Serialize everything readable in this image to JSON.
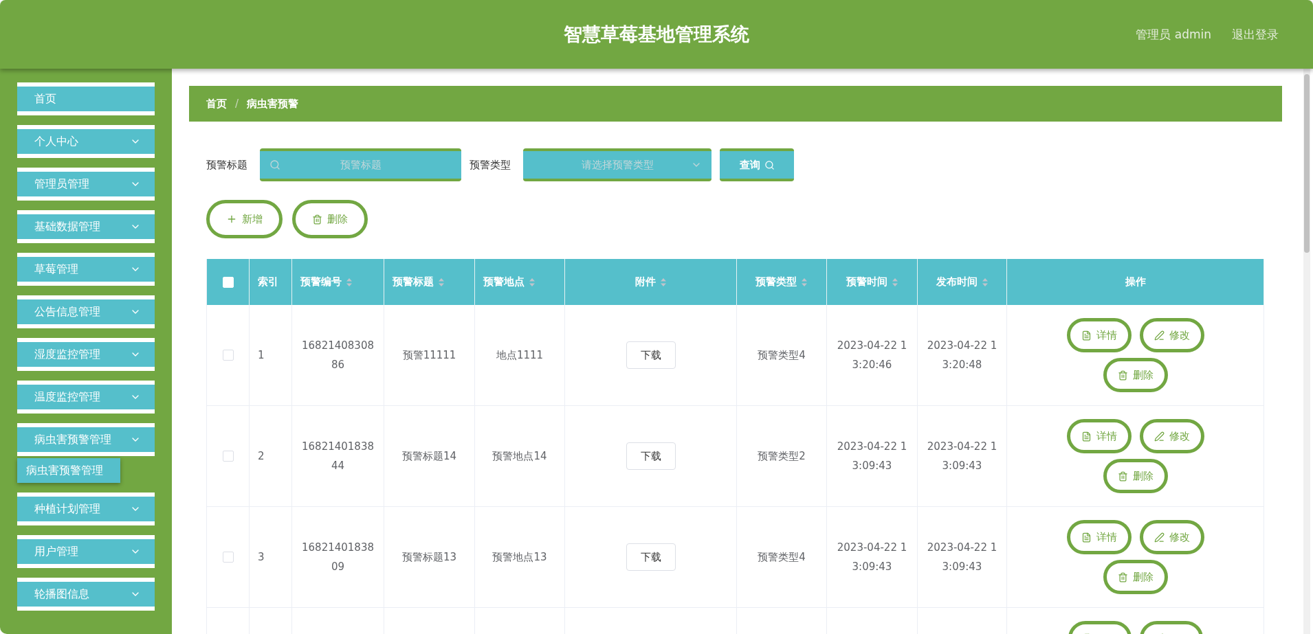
{
  "header": {
    "title": "智慧草莓基地管理系统",
    "user": "管理员 admin",
    "logout": "退出登录"
  },
  "sidebar": {
    "items": [
      {
        "label": "首页",
        "expandable": false
      },
      {
        "label": "个人中心",
        "expandable": true
      },
      {
        "label": "管理员管理",
        "expandable": true
      },
      {
        "label": "基础数据管理",
        "expandable": true
      },
      {
        "label": "草莓管理",
        "expandable": true
      },
      {
        "label": "公告信息管理",
        "expandable": true
      },
      {
        "label": "湿度监控管理",
        "expandable": true
      },
      {
        "label": "温度监控管理",
        "expandable": true
      },
      {
        "label": "病虫害预警管理",
        "expandable": true,
        "children": [
          {
            "label": "病虫害预警管理",
            "selected": true
          }
        ]
      },
      {
        "label": "种植计划管理",
        "expandable": true
      },
      {
        "label": "用户管理",
        "expandable": true
      },
      {
        "label": "轮播图信息",
        "expandable": true
      }
    ]
  },
  "breadcrumb": {
    "separator": "/",
    "items": [
      "首页",
      "病虫害预警"
    ]
  },
  "search": {
    "fields": [
      {
        "kind": "text",
        "label": "预警标题",
        "placeholder": "预警标题"
      },
      {
        "kind": "select",
        "label": "预警类型",
        "placeholder": "请选择预警类型"
      }
    ],
    "button": "查询"
  },
  "toolbar": [
    {
      "kind": "add",
      "label": "新增"
    },
    {
      "kind": "delete",
      "label": "删除"
    }
  ],
  "table": {
    "select_all": {
      "checked": false
    },
    "columns": [
      {
        "label": "索引",
        "sortable": false
      },
      {
        "label": "预警编号",
        "sortable": true
      },
      {
        "label": "预警标题",
        "sortable": true
      },
      {
        "label": "预警地点",
        "sortable": true
      },
      {
        "label": "附件",
        "sortable": true
      },
      {
        "label": "预警类型",
        "sortable": true
      },
      {
        "label": "预警时间",
        "sortable": true
      },
      {
        "label": "发布时间",
        "sortable": true
      },
      {
        "label": "操作",
        "sortable": false
      }
    ],
    "rows": [
      {
        "checked": false,
        "cells": [
          "1",
          "1682140830886",
          "预警11111",
          "地点1111",
          "下载",
          "预警类型4",
          "2023-04-22 13:20:46",
          "2023-04-22 13:20:48"
        ],
        "actions": [
          {
            "kind": "detail",
            "label": "详情"
          },
          {
            "kind": "edit",
            "label": "修改"
          },
          {
            "kind": "delete",
            "label": "删除"
          }
        ]
      },
      {
        "checked": false,
        "cells": [
          "2",
          "1682140183844",
          "预警标题14",
          "预警地点14",
          "下载",
          "预警类型2",
          "2023-04-22 13:09:43",
          "2023-04-22 13:09:43"
        ],
        "actions": [
          {
            "kind": "detail",
            "label": "详情"
          },
          {
            "kind": "edit",
            "label": "修改"
          },
          {
            "kind": "delete",
            "label": "删除"
          }
        ]
      },
      {
        "checked": false,
        "cells": [
          "3",
          "1682140183809",
          "预警标题13",
          "预警地点13",
          "下载",
          "预警类型4",
          "2023-04-22 13:09:43",
          "2023-04-22 13:09:43"
        ],
        "actions": [
          {
            "kind": "detail",
            "label": "详情"
          },
          {
            "kind": "edit",
            "label": "修改"
          },
          {
            "kind": "delete",
            "label": "删除"
          }
        ]
      },
      {
        "cells": [],
        "actions": [
          {
            "kind": "detail"
          },
          {
            "kind": "edit"
          }
        ]
      }
    ]
  }
}
